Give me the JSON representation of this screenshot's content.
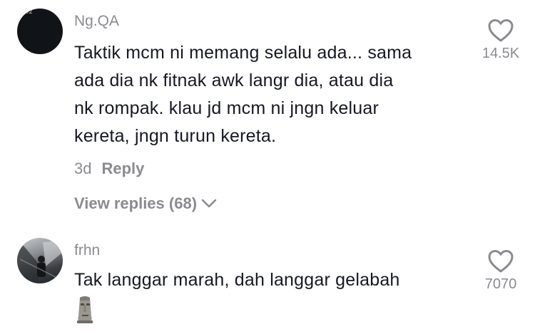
{
  "comments": [
    {
      "avatar_corner": "0:02",
      "username": "Ng.QA",
      "text": "Taktik mcm ni memang selalu ada... sama\nada dia nk fitnak awk langr dia, atau dia\nnk rompak. klau jd mcm ni jngn keluar\nkereta, jngn turun kereta.",
      "time": "3d",
      "reply_label": "Reply",
      "view_replies": "View replies (68)",
      "likes": "14.5K"
    },
    {
      "username": "frhn",
      "text": "Tak langgar marah, dah langgar gelabah",
      "likes": "7070",
      "emoji": "moai-icon"
    }
  ],
  "colors": {
    "text": "#161823",
    "muted": "#8a8b91"
  }
}
